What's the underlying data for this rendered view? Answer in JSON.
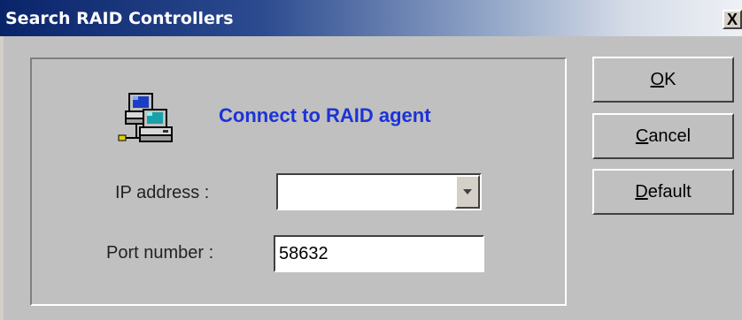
{
  "window": {
    "title": "Search RAID Controllers",
    "close_label": "X"
  },
  "main": {
    "heading": "Connect to RAID agent",
    "icon": "networked-computers-icon",
    "accent_color": "#1c33d6"
  },
  "form": {
    "ip_label": "IP  address :",
    "ip_value": "",
    "port_label": "Port number :",
    "port_value": "58632"
  },
  "buttons": {
    "ok": {
      "mnemonic": "O",
      "rest": "K"
    },
    "cancel": {
      "mnemonic": "C",
      "rest": "ancel"
    },
    "default": {
      "mnemonic": "D",
      "rest": "efault"
    }
  }
}
